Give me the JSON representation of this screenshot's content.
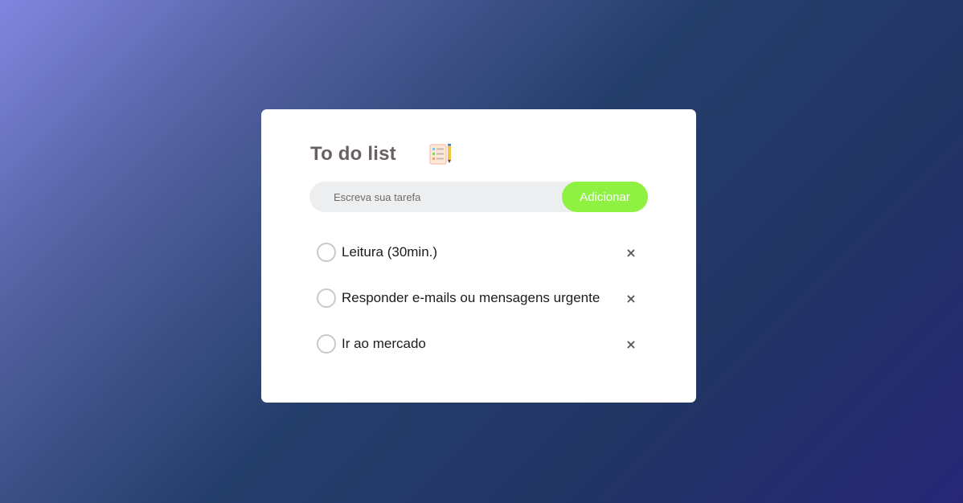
{
  "app": {
    "title": "To do list",
    "title_icon": "notepad-checklist-icon"
  },
  "input": {
    "placeholder": "Escreva sua tarefa",
    "value": ""
  },
  "add_button": {
    "label": "Adicionar",
    "color": "#8ff243"
  },
  "tasks": [
    {
      "text": "Leitura (30min.)",
      "checked": false,
      "remove_label": "×"
    },
    {
      "text": "Responder e-mails ou mensagens urgente",
      "checked": false,
      "remove_label": "×"
    },
    {
      "text": "Ir ao mercado",
      "checked": false,
      "remove_label": "×"
    }
  ],
  "colors": {
    "card_background": "#ffffff",
    "title": "#6a5f66",
    "input_background": "#edeef0"
  }
}
